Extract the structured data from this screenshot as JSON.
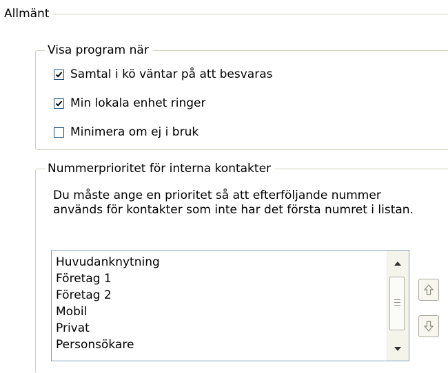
{
  "section": {
    "title": "Allmänt"
  },
  "visa_group": {
    "title": "Visa program när",
    "options": [
      {
        "label": "Samtal i kö väntar på att besvaras",
        "checked": true
      },
      {
        "label": "Min lokala enhet ringer",
        "checked": true
      },
      {
        "label": "Minimera om ej i bruk",
        "checked": false
      }
    ]
  },
  "priority_group": {
    "title": "Nummerprioritet för interna kontakter",
    "description": "Du måste ange en prioritet så att efterföljande nummer används för kontakter som inte har det första numret i listan.",
    "items": [
      "Huvudanknytning",
      "Företag 1",
      "Företag 2",
      "Mobil",
      "Privat",
      "Personsökare"
    ]
  },
  "icons": {
    "check": "checkmark-icon",
    "move_up": "arrow-up-icon",
    "move_down": "arrow-down-icon",
    "scroll_up": "scroll-up-arrow-icon",
    "scroll_down": "scroll-down-arrow-icon"
  },
  "colors": {
    "check": "#21a121",
    "group_border": "#d0d0bf",
    "listbox_border": "#7f9db9"
  }
}
